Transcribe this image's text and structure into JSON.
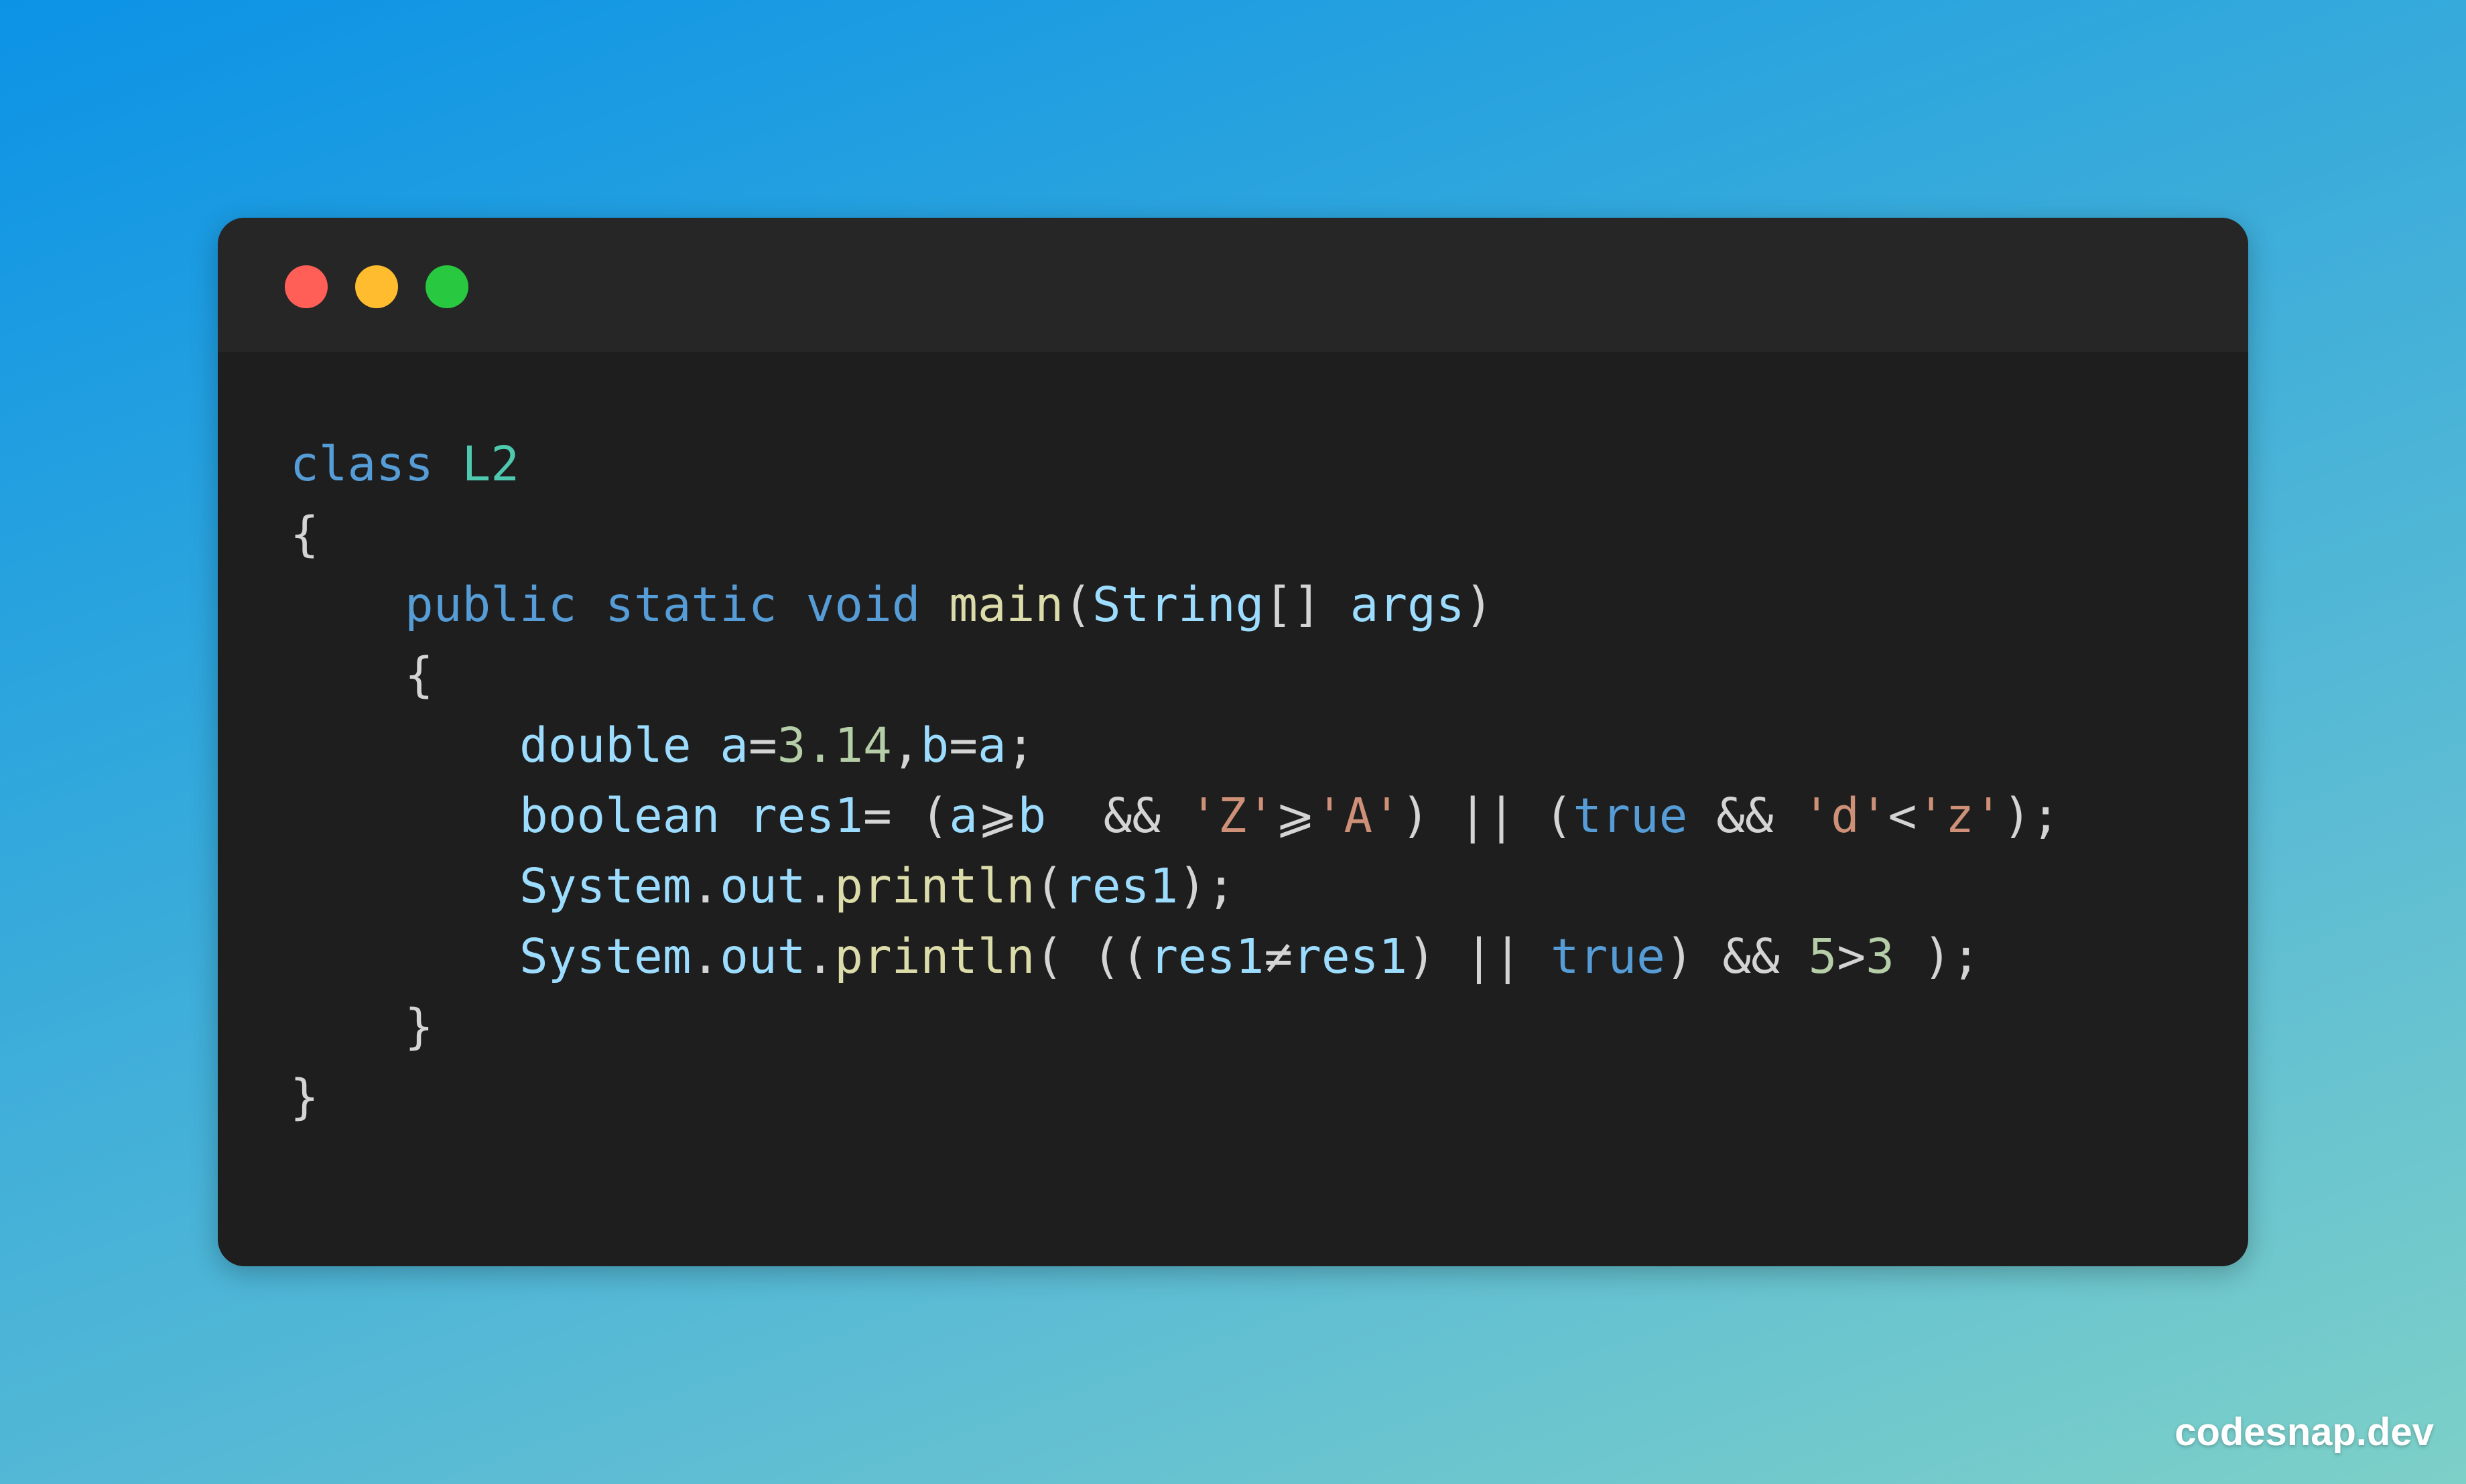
{
  "window": {
    "controls": {
      "close_color": "#ff5f57",
      "minimize_color": "#febc2e",
      "maximize_color": "#28c840"
    }
  },
  "code": {
    "lines": [
      [
        {
          "t": "class ",
          "k": "kw"
        },
        {
          "t": "L2",
          "k": "cls"
        }
      ],
      [
        {
          "t": "{",
          "k": "punc"
        }
      ],
      [
        {
          "t": "    ",
          "k": "punc"
        },
        {
          "t": "public",
          "k": "kw"
        },
        {
          "t": " ",
          "k": "punc"
        },
        {
          "t": "static",
          "k": "kw"
        },
        {
          "t": " ",
          "k": "punc"
        },
        {
          "t": "void",
          "k": "kw"
        },
        {
          "t": " ",
          "k": "punc"
        },
        {
          "t": "main",
          "k": "fn"
        },
        {
          "t": "(",
          "k": "punc"
        },
        {
          "t": "String",
          "k": "var"
        },
        {
          "t": "[] ",
          "k": "punc"
        },
        {
          "t": "args",
          "k": "var"
        },
        {
          "t": ")",
          "k": "punc"
        }
      ],
      [
        {
          "t": "    {",
          "k": "punc"
        }
      ],
      [
        {
          "t": "        ",
          "k": "punc"
        },
        {
          "t": "double",
          "k": "var"
        },
        {
          "t": " ",
          "k": "punc"
        },
        {
          "t": "a",
          "k": "var"
        },
        {
          "t": "=",
          "k": "punc"
        },
        {
          "t": "3.14",
          "k": "num"
        },
        {
          "t": ",",
          "k": "punc"
        },
        {
          "t": "b",
          "k": "var"
        },
        {
          "t": "=",
          "k": "punc"
        },
        {
          "t": "a",
          "k": "var"
        },
        {
          "t": ";",
          "k": "punc"
        }
      ],
      [
        {
          "t": "        ",
          "k": "punc"
        },
        {
          "t": "boolean",
          "k": "var"
        },
        {
          "t": " ",
          "k": "punc"
        },
        {
          "t": "res1",
          "k": "var"
        },
        {
          "t": "= (",
          "k": "punc"
        },
        {
          "t": "a",
          "k": "var"
        },
        {
          "t": "⩾",
          "k": "punc"
        },
        {
          "t": "b",
          "k": "var"
        },
        {
          "t": "  && ",
          "k": "punc"
        },
        {
          "t": "'Z'",
          "k": "str"
        },
        {
          "t": "⩾",
          "k": "punc"
        },
        {
          "t": "'A'",
          "k": "str"
        },
        {
          "t": ") || (",
          "k": "punc"
        },
        {
          "t": "true",
          "k": "kw"
        },
        {
          "t": " && ",
          "k": "punc"
        },
        {
          "t": "'d'",
          "k": "str"
        },
        {
          "t": "<",
          "k": "punc"
        },
        {
          "t": "'z'",
          "k": "str"
        },
        {
          "t": ");",
          "k": "punc"
        }
      ],
      [
        {
          "t": "        ",
          "k": "punc"
        },
        {
          "t": "System",
          "k": "var"
        },
        {
          "t": ".",
          "k": "punc"
        },
        {
          "t": "out",
          "k": "var"
        },
        {
          "t": ".",
          "k": "punc"
        },
        {
          "t": "println",
          "k": "fn"
        },
        {
          "t": "(",
          "k": "punc"
        },
        {
          "t": "res1",
          "k": "var"
        },
        {
          "t": ");",
          "k": "punc"
        }
      ],
      [
        {
          "t": "        ",
          "k": "punc"
        },
        {
          "t": "System",
          "k": "var"
        },
        {
          "t": ".",
          "k": "punc"
        },
        {
          "t": "out",
          "k": "var"
        },
        {
          "t": ".",
          "k": "punc"
        },
        {
          "t": "println",
          "k": "fn"
        },
        {
          "t": "( ((",
          "k": "punc"
        },
        {
          "t": "res1",
          "k": "var"
        },
        {
          "t": "≠",
          "k": "punc"
        },
        {
          "t": "res1",
          "k": "var"
        },
        {
          "t": ") || ",
          "k": "punc"
        },
        {
          "t": "true",
          "k": "kw"
        },
        {
          "t": ") && ",
          "k": "punc"
        },
        {
          "t": "5",
          "k": "num"
        },
        {
          "t": ">",
          "k": "punc"
        },
        {
          "t": "3",
          "k": "num"
        },
        {
          "t": " );",
          "k": "punc"
        }
      ],
      [
        {
          "t": "    }",
          "k": "punc"
        }
      ],
      [
        {
          "t": "}",
          "k": "punc"
        }
      ]
    ]
  },
  "watermark": "codesnap.dev"
}
